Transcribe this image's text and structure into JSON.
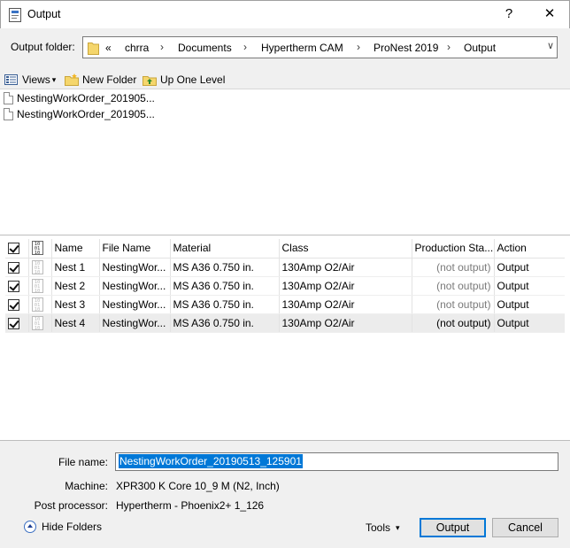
{
  "window": {
    "title": "Output",
    "help_label": "?",
    "close_label": "✕"
  },
  "output_folder": {
    "label": "Output folder:",
    "overflow": "«",
    "crumbs": [
      "chrra",
      "Documents",
      "Hypertherm CAM",
      "ProNest 2019",
      "Output"
    ],
    "separator": "›",
    "dropdown": "∨"
  },
  "toolbar": {
    "views_label": "Views",
    "views_arrow": "▾",
    "new_folder_label": "New Folder",
    "up_level_label": "Up One Level"
  },
  "files": [
    "NestingWorkOrder_201905...",
    "NestingWorkOrder_201905..."
  ],
  "table": {
    "headers": [
      "Name",
      "File Name",
      "Material",
      "Class",
      "Production Sta...",
      "Action"
    ],
    "rows": [
      {
        "name": "Nest 1",
        "file": "NestingWor...",
        "material": "MS A36 0.750 in.",
        "class": "130Amp O2/Air",
        "status": "(not output)",
        "action": "Output"
      },
      {
        "name": "Nest 2",
        "file": "NestingWor...",
        "material": "MS A36 0.750 in.",
        "class": "130Amp O2/Air",
        "status": "(not output)",
        "action": "Output"
      },
      {
        "name": "Nest 3",
        "file": "NestingWor...",
        "material": "MS A36 0.750 in.",
        "class": "130Amp O2/Air",
        "status": "(not output)",
        "action": "Output"
      },
      {
        "name": "Nest 4",
        "file": "NestingWor...",
        "material": "MS A36 0.750 in.",
        "class": "130Amp O2/Air",
        "status": "(not output)",
        "action": "Output"
      }
    ]
  },
  "form": {
    "file_name_label": "File name:",
    "file_name_value": "NestingWorkOrder_20190513_125901",
    "machine_label": "Machine:",
    "machine_value": "XPR300 K Core 10_9 M (N2, Inch)",
    "post_label": "Post processor:",
    "post_value": "Hypertherm - Phoenix2+ 1_126"
  },
  "buttons": {
    "hide_folders": "Hide Folders",
    "tools": "Tools",
    "tools_arrow": "▾",
    "output": "Output",
    "cancel": "Cancel"
  },
  "colors": {
    "accent": "#0078d7",
    "folder": "#f5d66c"
  }
}
